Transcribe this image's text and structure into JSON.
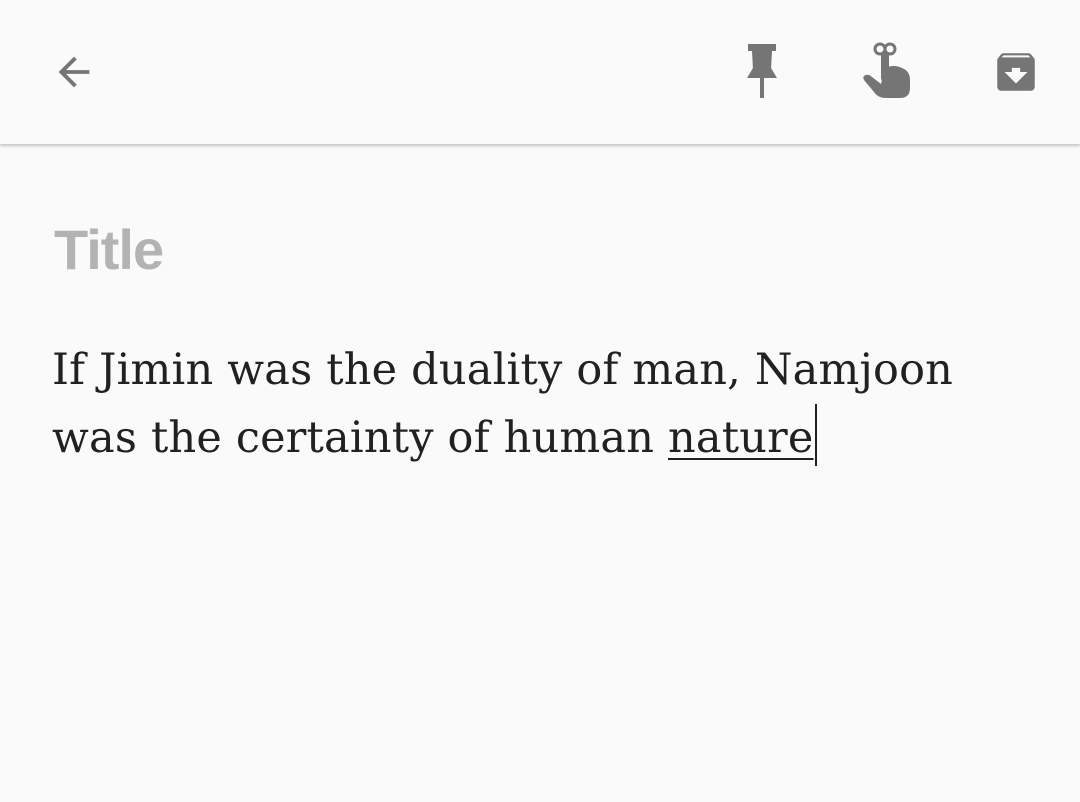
{
  "toolbar": {
    "back_icon": "arrow-back-icon",
    "pin_icon": "pushpin-icon",
    "reminder_icon": "reminder-hand-icon",
    "archive_icon": "archive-box-icon",
    "icon_color": "#757575"
  },
  "note": {
    "title_placeholder": "Title",
    "body_text": "If Jimin was the duality of man, Namjoon was the certainty of human ",
    "composing_word": "nature"
  },
  "colors": {
    "background": "#fafafa",
    "placeholder": "#b3b3b3",
    "text": "#212121"
  }
}
